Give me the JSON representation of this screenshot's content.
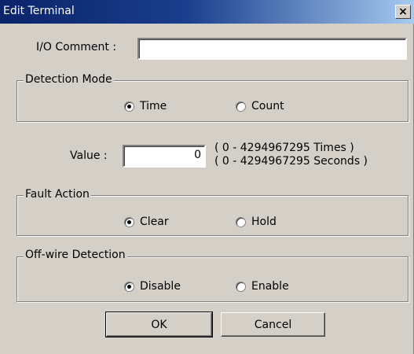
{
  "window": {
    "title": "Edit Terminal",
    "close_glyph": "×"
  },
  "io_comment": {
    "label": "I/O Comment :",
    "value": ""
  },
  "detection_mode": {
    "legend": "Detection Mode",
    "options": [
      {
        "label": "Time",
        "checked": true
      },
      {
        "label": "Count",
        "checked": false
      }
    ]
  },
  "value_field": {
    "label": "Value :",
    "value": "0",
    "range_times": "( 0 - 4294967295 Times )",
    "range_seconds": "( 0 - 4294967295 Seconds )"
  },
  "fault_action": {
    "legend": "Fault Action",
    "options": [
      {
        "label": "Clear",
        "checked": true
      },
      {
        "label": "Hold",
        "checked": false
      }
    ]
  },
  "offwire_detection": {
    "legend": "Off-wire Detection",
    "options": [
      {
        "label": "Disable",
        "checked": true
      },
      {
        "label": "Enable",
        "checked": false
      }
    ]
  },
  "buttons": {
    "ok": "OK",
    "cancel": "Cancel"
  }
}
